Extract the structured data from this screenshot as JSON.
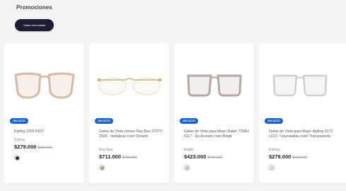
{
  "section": {
    "title": "Promociones"
  },
  "filter_chip": {
    "label": "Gafas formuladas"
  },
  "products": [
    {
      "discount": "10% DCTO",
      "name": "Kipling 3103 K637",
      "brand": "Kipling",
      "price": "$279.000",
      "old_price": "$310.000",
      "swatch_color": "#2a2a2a",
      "frame_color": "#d9b9a6",
      "frame_style": "cat-eye"
    },
    {
      "discount": "10% DCTO",
      "name": "Gafas de Vista Unisex Ray-Ban 3747V 2500 - metálicas color Dorado",
      "brand": "Ray-Ban",
      "price": "$711.000",
      "old_price": "$790.000",
      "swatch_color": "#b89a6a",
      "frame_color": "#cfb27a",
      "frame_style": "rimless"
    },
    {
      "discount": "10% DCTO",
      "name": "Gafas de Vista para Mujer Ralph 7158U 6117 - En Acetato color Beige",
      "brand": "Ralph",
      "price": "$423.000",
      "old_price": "$470.000",
      "swatch_color": "#cfc3b8",
      "frame_color": "#b8a7a0",
      "frame_style": "square"
    },
    {
      "discount": "10% DCTO",
      "name": "Gafas de Vista para Mujer Kipling 3172 L613 - Vayestadas color Transparente",
      "brand": "Kipling",
      "price": "$279.000",
      "old_price": "$310.000",
      "swatch_color": "#e8e8e8",
      "frame_color": "#cfcfcf",
      "frame_style": "square"
    }
  ]
}
